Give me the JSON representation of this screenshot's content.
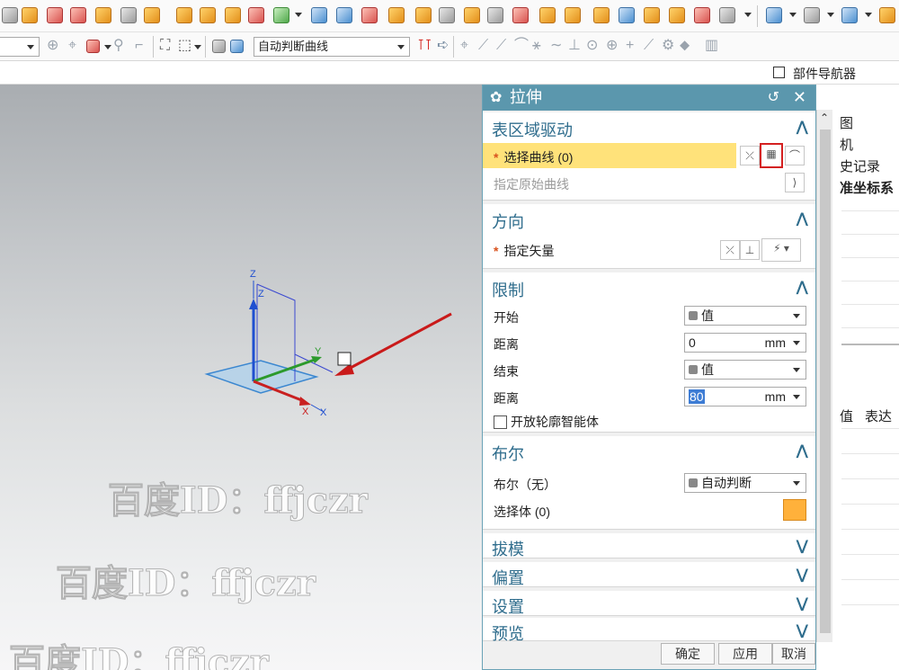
{
  "toolbar2": {
    "curve_rule": "自动判断曲线"
  },
  "navigator": {
    "title": "部件导航器",
    "tree_items": [
      "图",
      "机",
      "史记录",
      "准坐标系"
    ],
    "columns": [
      "值",
      "表达"
    ]
  },
  "viewport": {
    "triad_axes": [
      "Z",
      "Y",
      "X"
    ],
    "watermark": "百度ID：ffjczr"
  },
  "dialog": {
    "title": "拉伸",
    "sections": {
      "section_region": {
        "title": "表区域驱动",
        "select_curve": "选择曲线 (0)",
        "specify_origin": "指定原始曲线"
      },
      "direction": {
        "title": "方向",
        "specify_vector": "指定矢量"
      },
      "limits": {
        "title": "限制",
        "start_label": "开始",
        "start_value": "值",
        "distance1_label": "距离",
        "distance1_value": "0",
        "unit": "mm",
        "end_label": "结束",
        "end_value": "值",
        "distance2_label": "距离",
        "distance2_value": "80",
        "open_profile": "开放轮廓智能体"
      },
      "boolean": {
        "title": "布尔",
        "bool_label": "布尔（无）",
        "bool_value": "自动判断",
        "select_body": "选择体 (0)"
      },
      "draft": {
        "title": "拔模"
      },
      "offset": {
        "title": "偏置"
      },
      "settings": {
        "title": "设置"
      },
      "preview": {
        "title": "预览"
      }
    },
    "buttons": {
      "ok": "确定",
      "apply": "应用",
      "cancel": "取消"
    }
  }
}
